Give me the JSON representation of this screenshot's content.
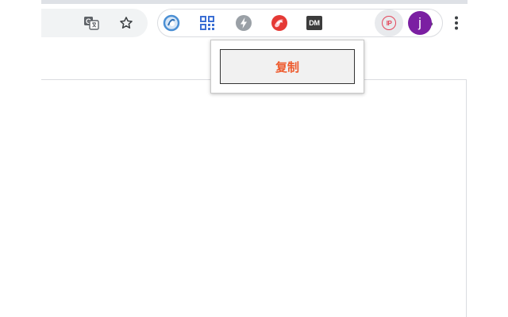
{
  "toolbar": {
    "icons": {
      "translate": "translate-icon",
      "bookmark": "star-icon",
      "menu": "more-vert-icon"
    },
    "extensions": [
      {
        "name": "ring-extension-icon",
        "color": "#4a8fd4"
      },
      {
        "name": "qr-code-extension-icon",
        "color": "#3b6fd4"
      },
      {
        "name": "bolt-extension-icon",
        "color": "#9aa0a6"
      },
      {
        "name": "red-swirl-extension-icon",
        "color": "#e53935"
      },
      {
        "name": "dm-extension-icon",
        "label": "DM"
      },
      {
        "name": "ip-extension-icon",
        "label": "IP",
        "color": "#e3455a"
      },
      {
        "name": "puzzle-extensions-icon",
        "color": "#5f6368"
      }
    ],
    "avatar": {
      "initial": "j",
      "color": "#7b1fa2"
    }
  },
  "popup": {
    "copy_label": "复制",
    "accent_color": "#ee5b2e"
  }
}
